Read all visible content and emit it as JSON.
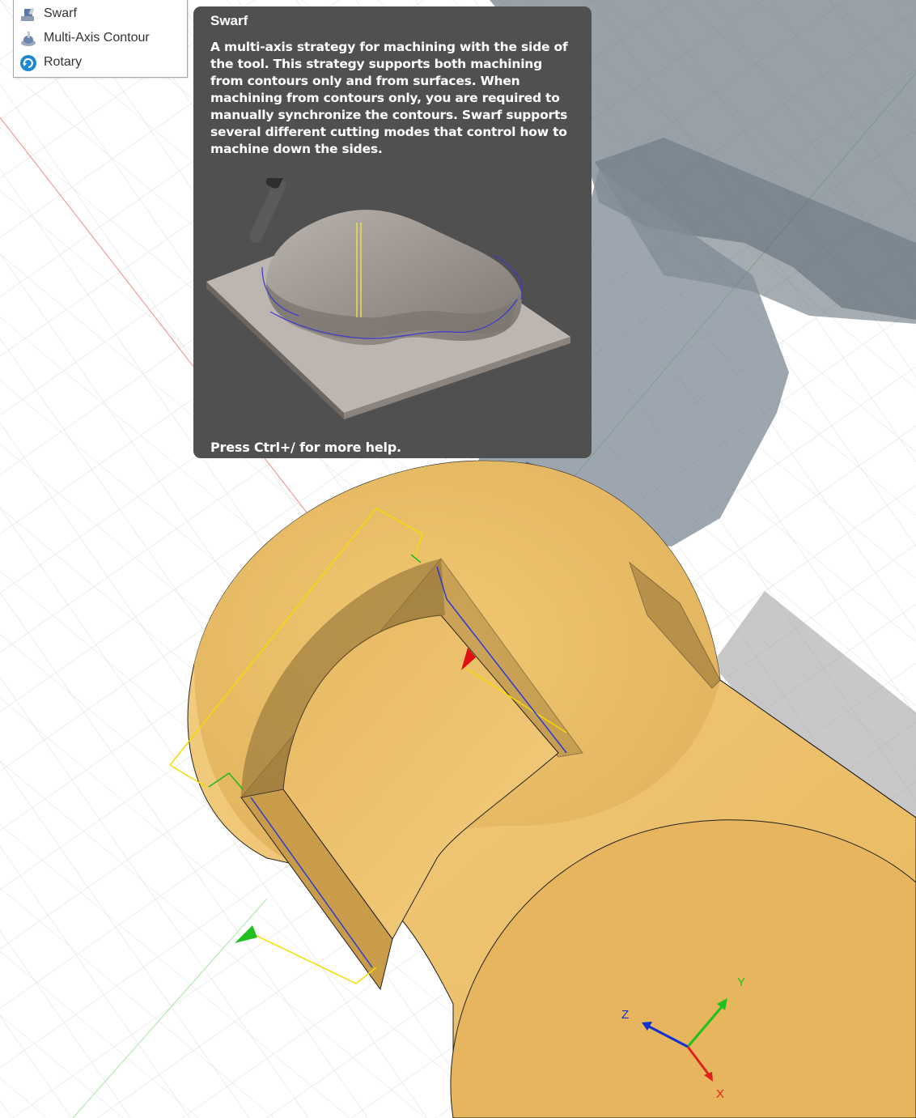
{
  "menu": {
    "items": [
      {
        "label": "Swarf",
        "icon": "swarf-icon"
      },
      {
        "label": "Multi-Axis Contour",
        "icon": "multi-axis-contour-icon"
      },
      {
        "label": "Rotary",
        "icon": "rotary-icon"
      }
    ]
  },
  "tooltip": {
    "title": "Swarf",
    "description": "A multi-axis strategy for machining with the side of the tool. This strategy supports both machining from contours only and from surfaces. When machining from contours only, you are required to manually synchronize the contours. Swarf supports several different cutting modes that control how to machine down the sides.",
    "footer": "Press Ctrl+/ for more help.",
    "image": "swarf-toolpath-preview"
  },
  "triad": {
    "x_label": "X",
    "y_label": "Y",
    "z_label": "Z"
  },
  "colors": {
    "part": "#F0C26A",
    "tool_holder": "#708090",
    "toolpath_contour": "#FFE000",
    "toolpath_cut": "#2B3BD0",
    "tooltip_bg": "#505050",
    "axis_x": "#E02020",
    "axis_y": "#20C020",
    "axis_z": "#1030D0"
  }
}
